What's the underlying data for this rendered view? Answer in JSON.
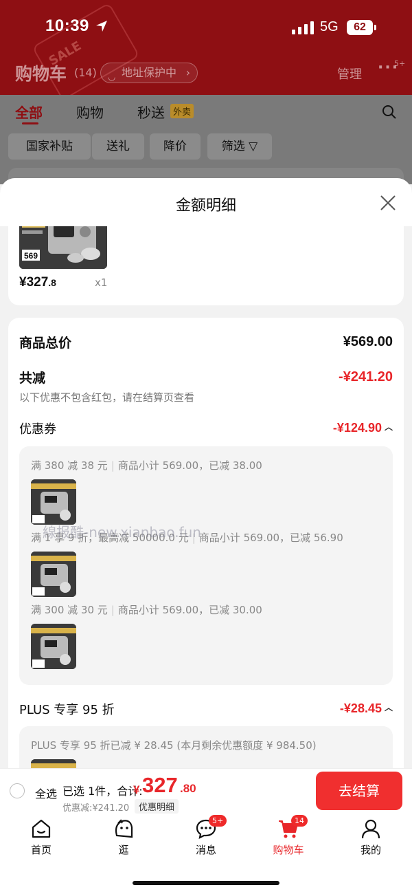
{
  "status_bar": {
    "time": "10:39",
    "network": "5G",
    "battery": "62"
  },
  "header": {
    "title": "购物车",
    "count": "(14)",
    "address_protect": "地址保护中",
    "manage": "管理",
    "more_badge": "5+"
  },
  "tabs": [
    {
      "label": "全部",
      "active": true
    },
    {
      "label": "购物"
    },
    {
      "label": "秒送",
      "badge": "外卖"
    }
  ],
  "filters": [
    "国家补贴",
    "送礼",
    "降价",
    "筛选"
  ],
  "sheet": {
    "title": "金额明细",
    "product": {
      "price_int": "¥327",
      "price_dec": ".8",
      "qty": "x1",
      "thumb_price": "569"
    },
    "total_label": "商品总价",
    "total_value": "¥569.00",
    "reduce_label": "共减",
    "reduce_value": "-¥241.20",
    "reduce_note": "以下优惠不包含红包，请在结算页查看",
    "coupon_label": "优惠券",
    "coupon_value": "-¥124.90",
    "coupons": [
      {
        "rule": "满 380 减 38 元",
        "detail": "商品小计 569.00，已减 38.00"
      },
      {
        "rule": "满 1 享 9 折，最高减 50000.0 元",
        "detail": "商品小计 569.00，已减 56.90"
      },
      {
        "rule": "满 300 减 30 元",
        "detail": "商品小计 569.00，已减 30.00"
      }
    ],
    "watermark": "線报酷-new.xianbao.fun",
    "plus_label": "PLUS 专享 95 折",
    "plus_value": "-¥28.45",
    "plus_note": "PLUS 专享 95 折已减 ¥ 28.45 (本月剩余优惠额度 ¥ 984.50)"
  },
  "checkout": {
    "select_all": "全选",
    "selected": "已选 1件，合计:",
    "currency": "¥",
    "total_int": "327",
    "total_dec": ".80",
    "discount": "优惠减:¥241.20",
    "detail_link": "优惠明细",
    "pay": "去结算"
  },
  "tabbar": [
    {
      "label": "首页",
      "icon": "home-icon"
    },
    {
      "label": "逛",
      "icon": "face-icon"
    },
    {
      "label": "消息",
      "icon": "message-icon",
      "badge": "5+"
    },
    {
      "label": "购物车",
      "icon": "cart-icon",
      "badge": "14",
      "active": true
    },
    {
      "label": "我的",
      "icon": "person-icon"
    }
  ],
  "colors": {
    "brand_red": "#e8262a",
    "header_red": "#8e0f13"
  }
}
